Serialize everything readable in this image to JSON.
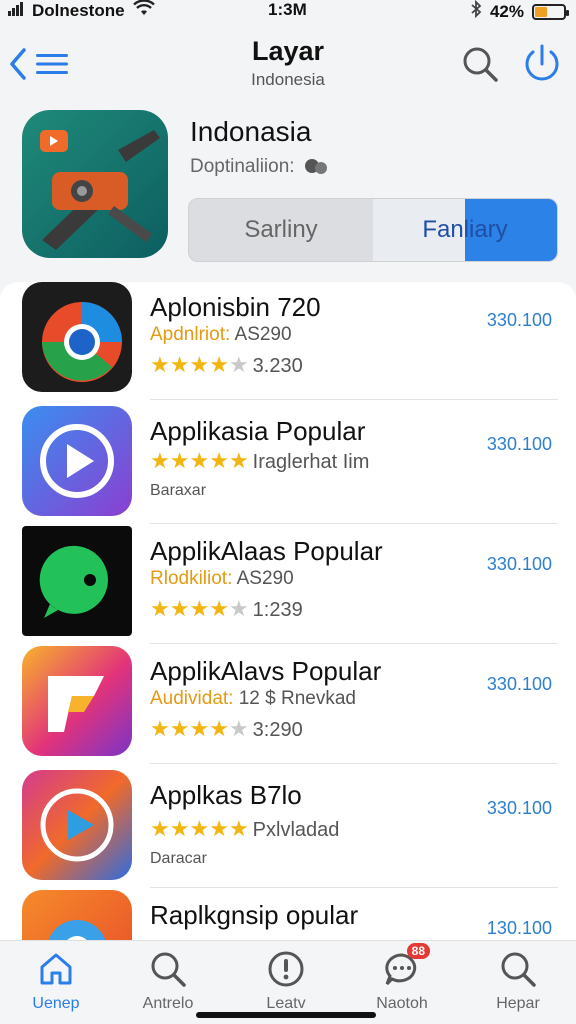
{
  "status_bar": {
    "carrier": "Dolnestone",
    "time": "1:3M",
    "battery": "42%",
    "battery_level": 0.42
  },
  "nav": {
    "title": "Layar",
    "subtitle": "Indonesia"
  },
  "hero": {
    "title": "Indonasia",
    "subtitle": "Doptinaliion:",
    "segments": [
      {
        "label": "Sarliny"
      },
      {
        "label": "Fanliary"
      }
    ]
  },
  "apps": [
    {
      "name": "Aplonisbin 720",
      "meta_left": "Apdnlriot:",
      "meta_right": "AS290",
      "rating": 3.5,
      "rating_text": "3.230",
      "extra": "",
      "price": "330.100",
      "color_a": "#e84b2a",
      "color_b": "#1e8de0"
    },
    {
      "name": "Applikasia Popular",
      "meta_left": "",
      "meta_right": "",
      "rating": 5,
      "rating_text": "Iraglerhat Iim",
      "extra": "Baraxar",
      "price": "330.100",
      "color_a": "#3a8ef0",
      "color_b": "#8b3fd1"
    },
    {
      "name": "ApplikAlaas Popular",
      "meta_left": "Rlodkiliot:",
      "meta_right": "AS290",
      "rating": 4,
      "rating_text": "1:239",
      "extra": "",
      "price": "330.100",
      "color_a": "#23c15a",
      "color_b": "#0b0b0b"
    },
    {
      "name": "ApplikAlavs Popular",
      "meta_left": "Audividat:",
      "meta_right": "12 $ Rnevkad",
      "rating": 4,
      "rating_text": "3:290",
      "extra": "",
      "price": "330.100",
      "color_a": "#f7b32b",
      "color_b": "#7a34c9"
    },
    {
      "name": "Applkas B7lo",
      "meta_left": "",
      "meta_right": "",
      "rating": 5,
      "rating_text": "Pxlvladad",
      "extra": "Daracar",
      "price": "330.100",
      "color_a": "#d43b8e",
      "color_b": "#2f6be0"
    },
    {
      "name": "Raplkgnsip opular",
      "meta_left": "",
      "meta_right": "",
      "rating": 0,
      "rating_text": "",
      "extra": "",
      "price": "130.100",
      "color_a": "#f58a2a",
      "color_b": "#3aa0e8"
    }
  ],
  "tabs": [
    {
      "label": "Uenep",
      "icon": "home-icon"
    },
    {
      "label": "Antrelo",
      "icon": "search-icon"
    },
    {
      "label": "Leatv",
      "icon": "info-icon"
    },
    {
      "label": "Naotoh",
      "icon": "chat-icon",
      "badge": "88"
    },
    {
      "label": "Hepar",
      "icon": "search-icon"
    }
  ],
  "colors": {
    "accent": "#2b7de9",
    "star": "#f2b511",
    "price": "#2e7fcf"
  }
}
